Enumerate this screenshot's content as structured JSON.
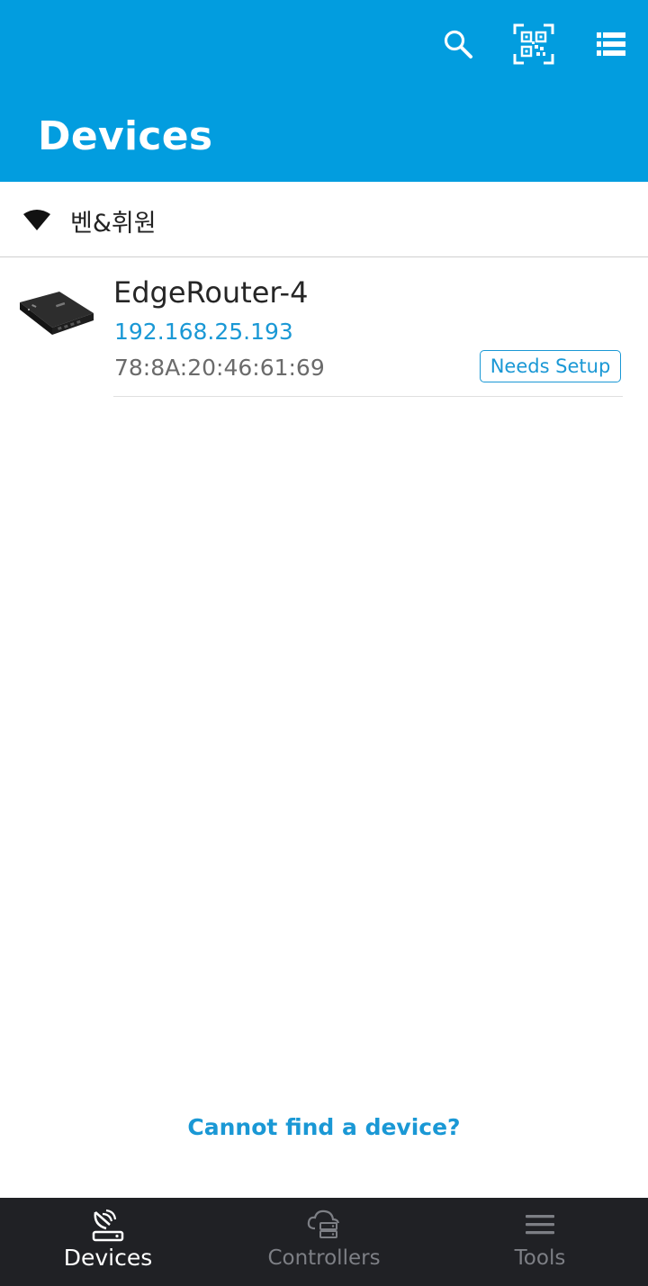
{
  "header": {
    "title": "Devices",
    "actions": [
      {
        "icon": "search-icon"
      },
      {
        "icon": "qr-code-icon"
      },
      {
        "icon": "list-view-icon"
      }
    ],
    "background": "#029ddf"
  },
  "network": {
    "icon": "wifi-icon",
    "name": "벤&휘원"
  },
  "devices": [
    {
      "name": "EdgeRouter-4",
      "ip": "192.168.25.193",
      "mac": "78:8A:20:46:61:69",
      "status": "Needs Setup"
    }
  ],
  "help_link": "Cannot find a device?",
  "bottom_nav": {
    "tabs": [
      {
        "label": "Devices",
        "icon": "devices-icon",
        "active": true
      },
      {
        "label": "Controllers",
        "icon": "cloud-controller-icon",
        "active": false
      },
      {
        "label": "Tools",
        "icon": "menu-icon",
        "active": false
      }
    ]
  },
  "colors": {
    "accent": "#1a98d5",
    "nav_bg": "#202125"
  }
}
